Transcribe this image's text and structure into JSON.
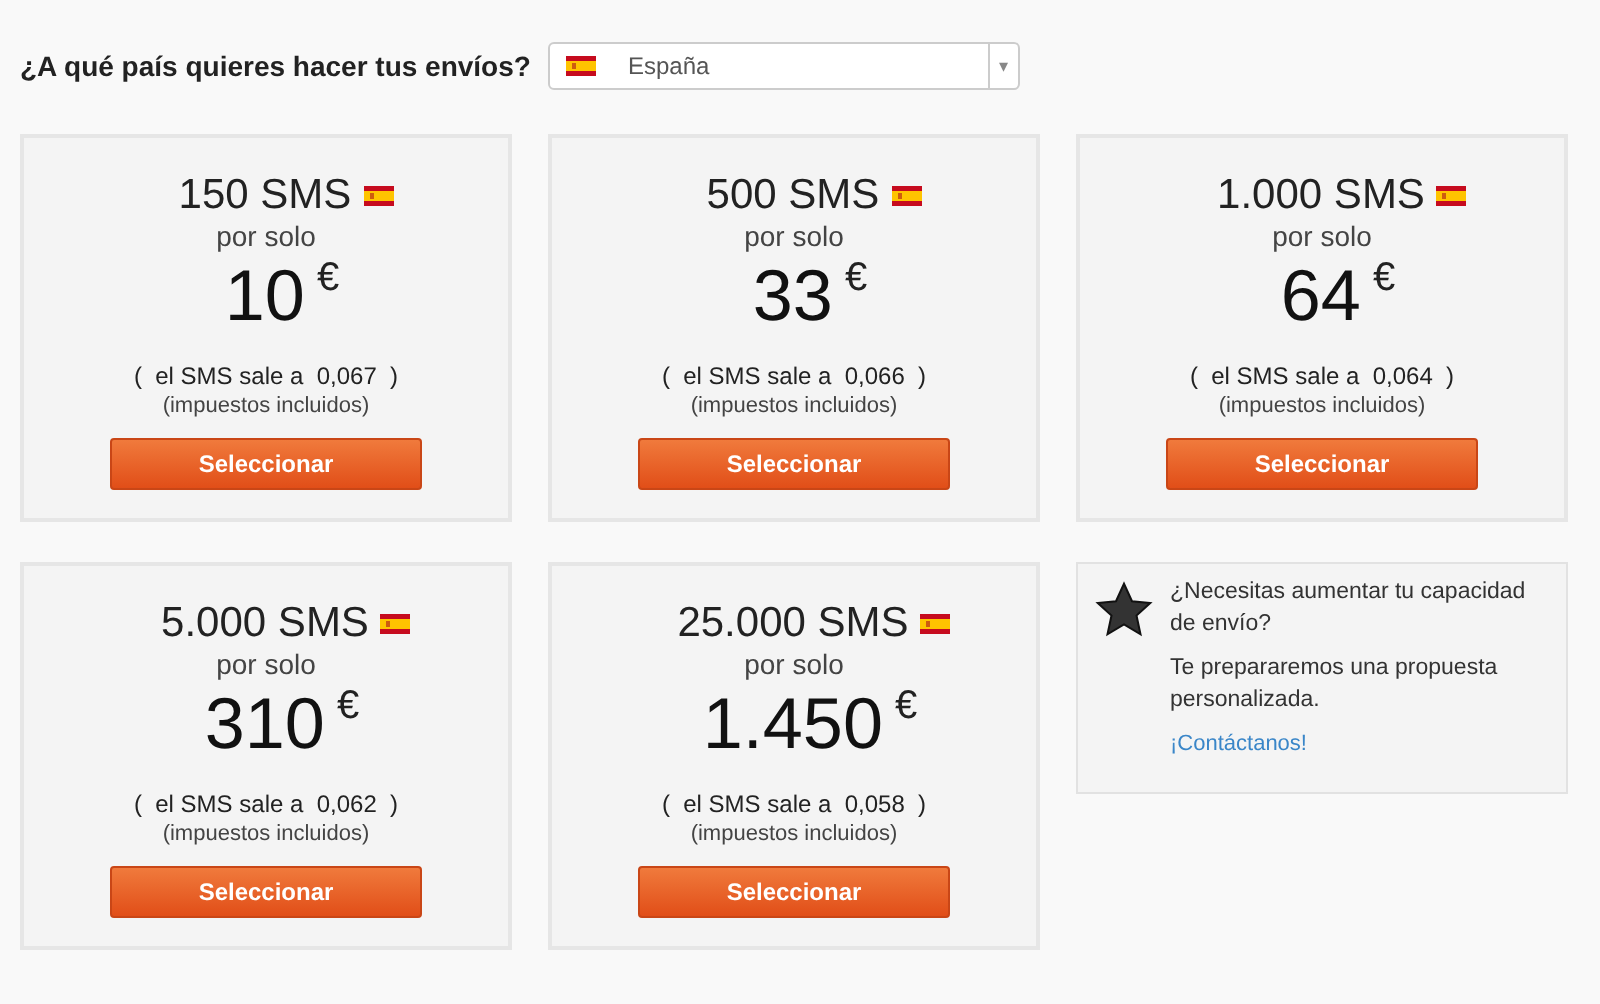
{
  "question": "¿A qué país quieres hacer tus envíos?",
  "country_select": {
    "value": "España",
    "arrow": "▾"
  },
  "plans": [
    {
      "title": "150 SMS",
      "subtitle": "por solo",
      "price": "10",
      "currency": "€",
      "unit_price": "(  el SMS sale a  0,067  )",
      "tax_note": "(impuestos incluidos)",
      "button": "Seleccionar"
    },
    {
      "title": "500 SMS",
      "subtitle": "por solo",
      "price": "33",
      "currency": "€",
      "unit_price": "(  el SMS sale a  0,066  )",
      "tax_note": "(impuestos incluidos)",
      "button": "Seleccionar"
    },
    {
      "title": "1.000 SMS",
      "subtitle": "por solo",
      "price": "64",
      "currency": "€",
      "unit_price": "(  el SMS sale a  0,064  )",
      "tax_note": "(impuestos incluidos)",
      "button": "Seleccionar"
    },
    {
      "title": "5.000 SMS",
      "subtitle": "por solo",
      "price": "310",
      "currency": "€",
      "unit_price": "(  el SMS sale a  0,062  )",
      "tax_note": "(impuestos incluidos)",
      "button": "Seleccionar"
    },
    {
      "title": "25.000 SMS",
      "subtitle": "por solo",
      "price": "1.450",
      "currency": "€",
      "unit_price": "(  el SMS sale a  0,058  )",
      "tax_note": "(impuestos incluidos)",
      "button": "Seleccionar"
    }
  ],
  "contact_box": {
    "heading": "¿Necesitas aumentar tu capacidad de envío?",
    "text": "Te prepararemos una propuesta personalizada.",
    "link": "¡Contáctanos!"
  }
}
